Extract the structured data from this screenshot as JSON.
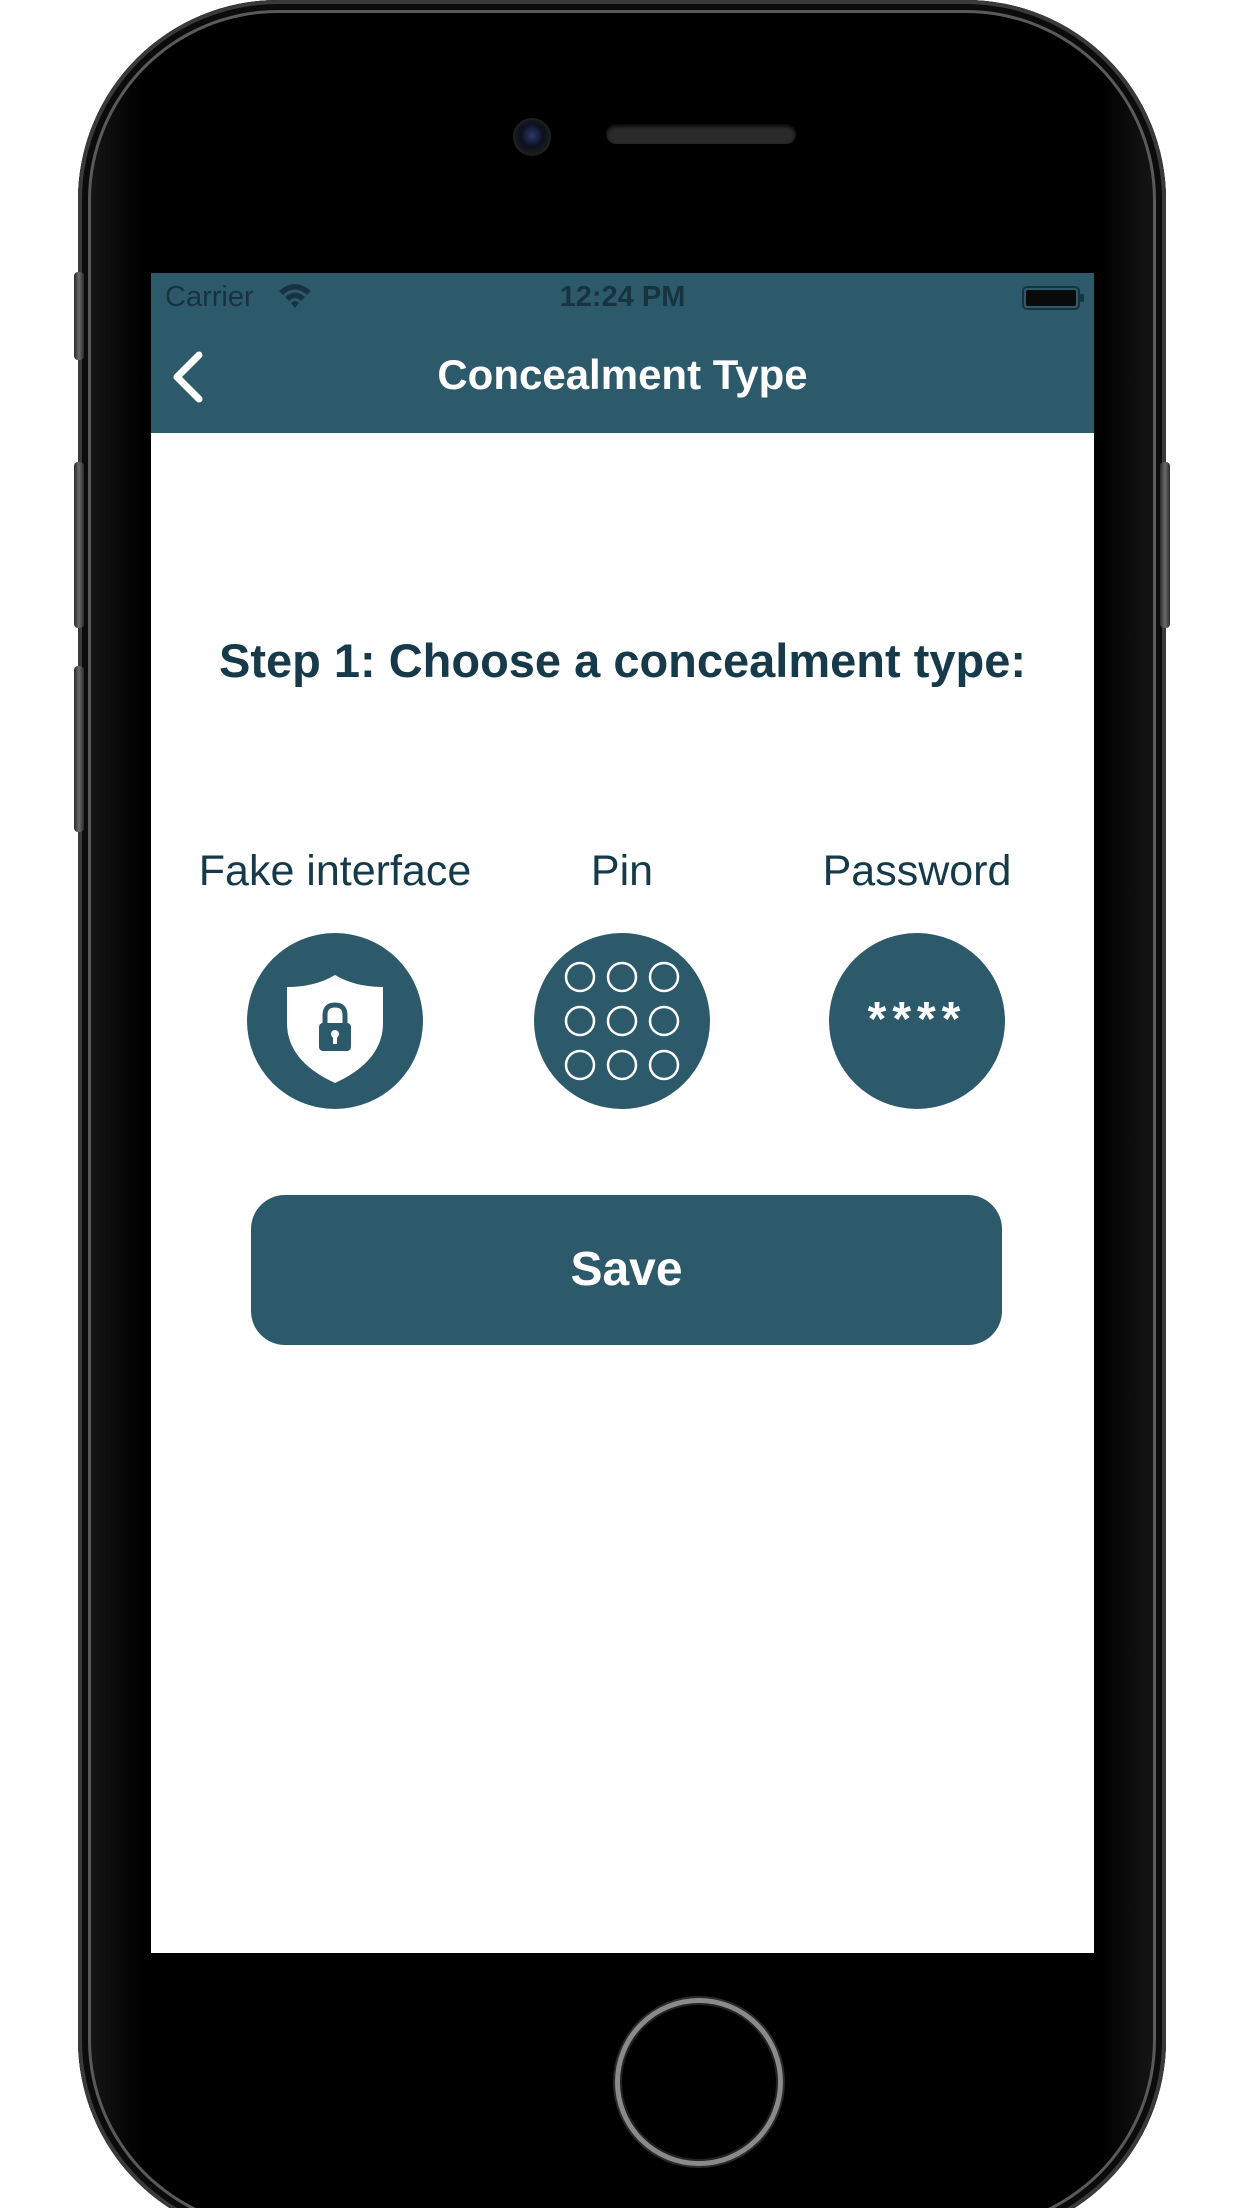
{
  "status_bar": {
    "carrier": "Carrier",
    "time": "12:24 PM",
    "wifi_icon": "wifi-icon",
    "battery_icon": "battery-icon"
  },
  "nav": {
    "back_icon": "chevron-left-icon",
    "title": "Concealment Type"
  },
  "main": {
    "step_title": "Step 1: Choose a concealment type:",
    "options": [
      {
        "label": "Fake interface",
        "icon": "shield-lock-icon"
      },
      {
        "label": "Pin",
        "icon": "pin-pad-icon"
      },
      {
        "label": "Password",
        "icon": "password-asterisks-icon",
        "glyph": "****"
      }
    ],
    "save_label": "Save"
  },
  "colors": {
    "accent": "#2d5a6b",
    "title_text": "#163a49",
    "background": "#ffffff"
  }
}
